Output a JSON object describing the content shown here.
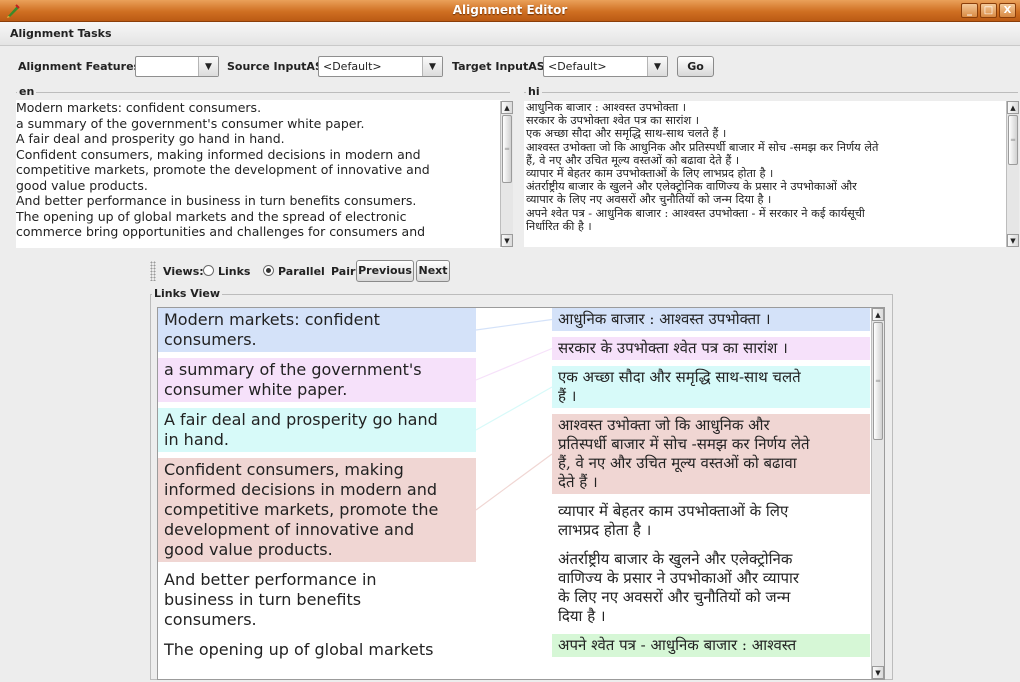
{
  "window": {
    "title": "Alignment Editor",
    "buttons": [
      "_",
      "□",
      "X"
    ]
  },
  "menu": {
    "items": [
      "Alignment Tasks"
    ]
  },
  "toolbar": {
    "features_label": "Alignment Features:",
    "features_value": "",
    "source_label": "Source InputAS:",
    "source_value": "<Default>",
    "target_label": "Target InputAS:",
    "target_value": "<Default>",
    "go_label": "Go"
  },
  "en_panel": {
    "title": "en",
    "lines": [
      "Modern markets:  confident consumers.",
      "a summary of the government's consumer white paper.",
      "A fair deal and prosperity go hand in hand.",
      "Confident consumers,  making informed decisions in modern and",
      "competitive markets,  promote the development of innovative and",
      "good value products.",
      "And better performance in business in turn benefits consumers.",
      "The opening up of global markets and the spread of electronic",
      "commerce bring opportunities and challenges for consumers and"
    ]
  },
  "hi_panel": {
    "title": "hi",
    "lines": [
      "आधुनिक बाजार :  आश्वस्त उपभोक्ता ।",
      "सरकार के उपभोक्ता श्वेत पत्र का सारांश ।",
      "एक अच्छा सौदा और समृद्धि साथ-साथ चलते हैं ।",
      "आश्वस्त उभोक्ता  जो कि आधुनिक और प्रतिस्पर्धी बाजार में सोच -समझ कर निर्णय लेते",
      "हैं,  वे नए और उचित  मूल्य वस्तओं को बढावा देते हैं ।",
      "व्यापार में बेहतर काम उपभोक्ताओं के लिए  लाभप्रद होता है ।",
      "अंतर्राष्ट्रीय बाजार के खुलने और एलेक्ट्रोनिक वाणिज्य के प्रसार ने उपभोकाओं  और",
      "व्यापार के लिए नए अवसरों और चुनौतियों को जन्म दिया है ।",
      "अपने श्वेत पत्र  -  आधुनिक बाजार :  आश्वस्त उपभोक्ता - में सरकार ने कई कार्यसूची",
      "निर्धारित की है ।"
    ]
  },
  "views": {
    "label": "Views:",
    "option_links": "Links",
    "option_parallel": "Parallel",
    "selected": "Parallel",
    "pair_label": "Pair:",
    "previous_label": "Previous",
    "next_label": "Next"
  },
  "links_view": {
    "title": "Links View",
    "en_segments": [
      {
        "lines": [
          "Modern markets: confident",
          "consumers."
        ],
        "color": "#d4e2f9"
      },
      {
        "lines": [
          "a summary of the government's",
          "consumer white paper."
        ],
        "color": "#f6e1fa"
      },
      {
        "lines": [
          "A fair deal and prosperity go hand",
          "in hand."
        ],
        "color": "#d7faf9"
      },
      {
        "lines": [
          "Confident consumers, making",
          "informed decisions in modern and",
          "competitive markets, promote the",
          "development of innovative and",
          "good value products."
        ],
        "color": "#f0d6d3"
      },
      {
        "lines": [
          "And better performance in",
          "business in turn benefits",
          "consumers."
        ],
        "color": "#ffffff"
      },
      {
        "lines": [
          "The opening up of global markets"
        ],
        "color": "#ffffff"
      }
    ],
    "hi_segments": [
      {
        "lines": [
          "आधुनिक बाजार : आश्वस्त उपभोक्ता ।"
        ],
        "color": "#d4e2f9"
      },
      {
        "lines": [
          "सरकार के उपभोक्ता श्वेत पत्र का सारांश ।"
        ],
        "color": "#f6e1fa"
      },
      {
        "lines": [
          "एक अच्छा सौदा और समृद्धि साथ-साथ चलते",
          "हैं ।"
        ],
        "color": "#d7faf9"
      },
      {
        "lines": [
          "आश्वस्त उभोक्ता जो कि आधुनिक और",
          "प्रतिस्पर्धी बाजार में सोच -समझ कर निर्णय लेते",
          "हैं, वे नए और उचित मूल्य वस्तओं को बढावा",
          "देते हैं ।"
        ],
        "color": "#f0d6d3"
      },
      {
        "lines": [
          "व्यापार में बेहतर काम उपभोक्ताओं के लिए",
          "लाभप्रद होता है ।"
        ],
        "color": "#ffffff"
      },
      {
        "lines": [
          "अंतर्राष्ट्रीय बाजार के खुलने और एलेक्ट्रोनिक",
          "वाणिज्य के प्रसार ने उपभोकाओं और व्यापार",
          "के लिए नए अवसरों और चुनौतियों को जन्म",
          "दिया है ।"
        ],
        "color": "#ffffff"
      },
      {
        "lines": [
          "अपने श्वेत पत्र  -  आधुनिक बाजार : आश्वस्त"
        ],
        "color": "#d6f7d6"
      }
    ],
    "link_color": "#9ec4e8"
  }
}
